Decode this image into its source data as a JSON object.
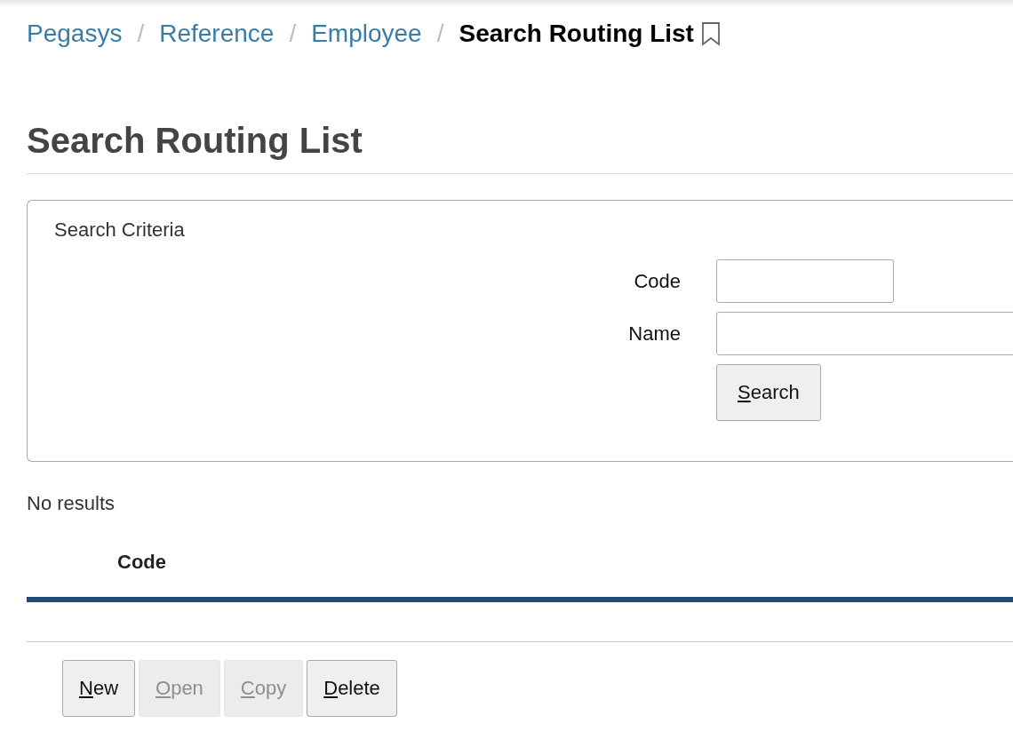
{
  "breadcrumb": {
    "links": [
      "Pegasys",
      "Reference",
      "Employee"
    ],
    "separators": [
      "/",
      "/",
      "/"
    ],
    "current": "Search Routing List"
  },
  "title": "Search Routing List",
  "search_criteria": {
    "legend": "Search Criteria",
    "fields": [
      {
        "label": "Code",
        "kind": "short"
      },
      {
        "label": "Name",
        "kind": "long"
      }
    ],
    "button": {
      "label": "Search",
      "underline_first": true,
      "disabled": false
    }
  },
  "results": {
    "message": "No results",
    "columns": [
      "Code"
    ]
  },
  "buttons": [
    {
      "label": "New",
      "underline_first": true,
      "disabled": false
    },
    {
      "label": "Open",
      "underline_first": true,
      "disabled": true
    },
    {
      "label": "Copy",
      "underline_first": true,
      "disabled": true
    },
    {
      "label": "Delete",
      "underline_first": true,
      "disabled": false
    }
  ]
}
